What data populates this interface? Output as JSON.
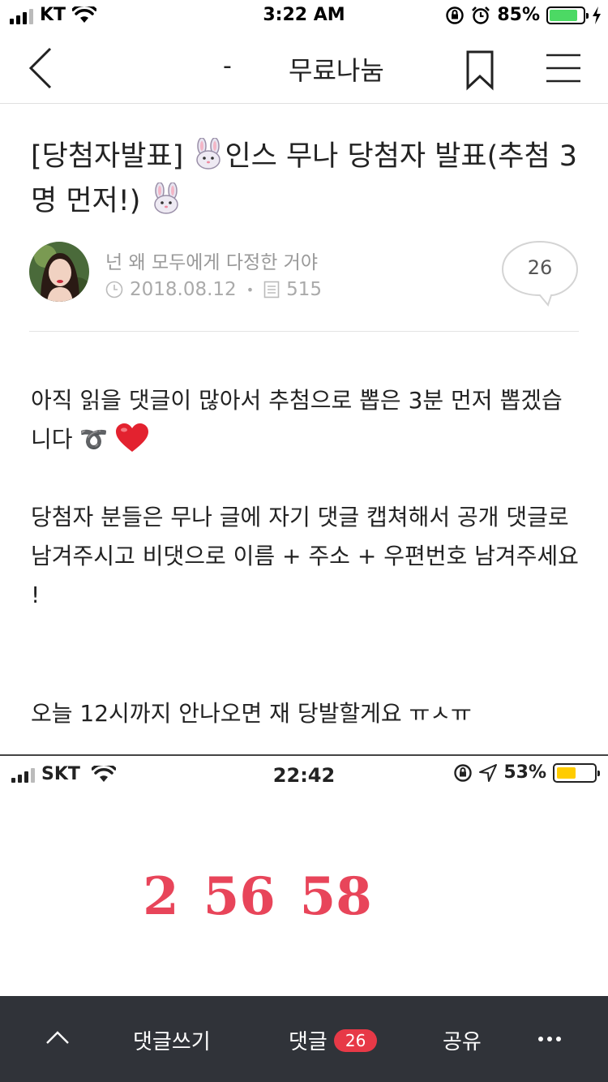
{
  "status_bar": {
    "carrier": "KT",
    "time": "3:22 AM",
    "battery_percent": "85%",
    "battery_level": 0.85,
    "battery_color": "#4cd964",
    "icons": [
      "signal-icon",
      "wifi-icon",
      "rotation-lock-icon",
      "alarm-icon",
      "battery-icon",
      "charging-icon"
    ]
  },
  "nav": {
    "separator": "-",
    "title": "무료나눔",
    "icons": [
      "back-icon",
      "bookmark-icon",
      "menu-icon"
    ]
  },
  "article": {
    "title_part1": "[당첨자발표] ",
    "title_part2": "인스 무나 당첨자 발표(추첨 3명 먼저!)",
    "title_emoji": "rabbit-face-icon",
    "author": "넌 왜 모두에게 다정한 거야",
    "date": "2018.08.12",
    "views": "515",
    "comment_count": "26",
    "paragraphs": [
      "아직 읽을 댓글이 많아서 추첨으로 뽑은 3분 먼저 뽑겠습니다 ➰",
      "당첨자 분들은 무나 글에 자기 댓글 캡쳐해서 공개 댓글로 남겨주시고 비댓으로 이름 + 주소 + 우편번호 남겨주세요 !",
      "오늘 12시까지 안나오면 재 당발할게요 ㅠㅅㅠ"
    ]
  },
  "embedded_screenshot": {
    "carrier": "SKT",
    "time": "22:42",
    "battery_percent": "53%",
    "battery_level": 0.53,
    "battery_color": "#ffcc00",
    "numbers": [
      "2",
      "56",
      "58"
    ],
    "number_color": "#e8455a"
  },
  "bottom_bar": {
    "write_comment": "댓글쓰기",
    "comments": "댓글",
    "comments_badge": "26",
    "share": "공유",
    "icons": [
      "scroll-up-icon",
      "more-icon"
    ]
  }
}
